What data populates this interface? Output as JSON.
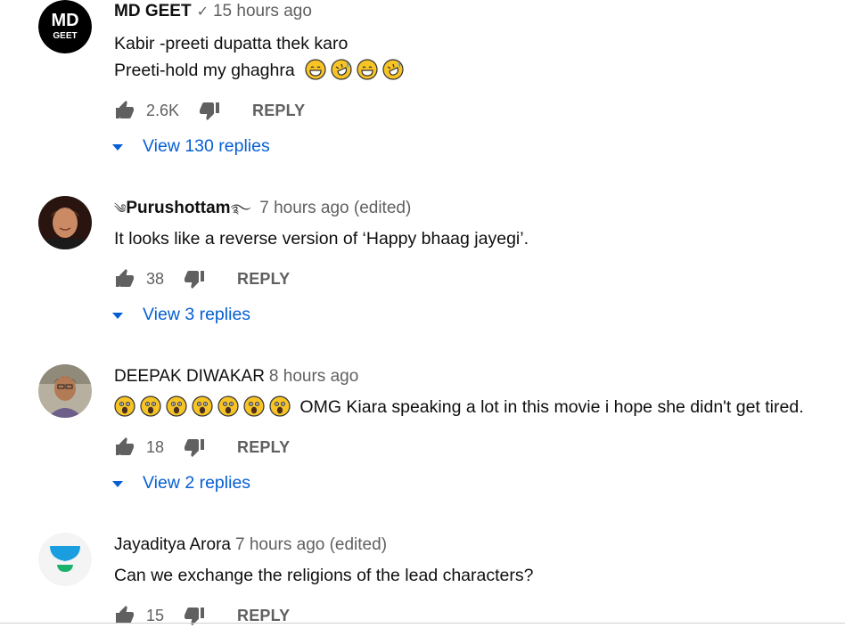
{
  "comments": [
    {
      "author": "MD GEET",
      "verified": true,
      "time": "15 hours ago",
      "avatar_text": "MD",
      "avatar_subtext": "GEET",
      "lines": [
        "Kabir -preeti dupatta thek karo",
        "Preeti-hold my ghaghra"
      ],
      "line2_emojis": [
        "grinning-sweat-emoji",
        "rofl-emoji",
        "grinning-sweat-emoji",
        "rofl-emoji"
      ],
      "likes": "2.6K",
      "reply_label": "REPLY",
      "view_replies": "View 130 replies"
    },
    {
      "author": "Purushottam",
      "time": "7 hours ago (edited)",
      "lines": [
        "It looks like a reverse version of ‘Happy bhaag jayegi’."
      ],
      "likes": "38",
      "reply_label": "REPLY",
      "view_replies": "View 3 replies"
    },
    {
      "author": "DEEPAK DIWAKAR",
      "time": "8 hours ago",
      "lines": [
        "OMG Kiara speaking a lot in this movie i hope she didn't get tired."
      ],
      "line_emojis": [
        "astonished-emoji",
        "astonished-emoji",
        "astonished-emoji",
        "astonished-emoji",
        "astonished-emoji",
        "astonished-emoji",
        "astonished-emoji"
      ],
      "likes": "18",
      "reply_label": "REPLY",
      "view_replies": "View 2 replies"
    },
    {
      "author": "Jayaditya Arora",
      "time": "7 hours ago (edited)",
      "lines": [
        "Can we exchange the religions of the lead characters?"
      ],
      "likes": "15",
      "reply_label": "REPLY"
    }
  ],
  "colors": {
    "link_blue": "#065fd4",
    "secondary_text": "#606060",
    "primary_text": "#0f0f0f",
    "unacademy_blue": "#1a9ee0",
    "unacademy_green": "#19b26b"
  }
}
